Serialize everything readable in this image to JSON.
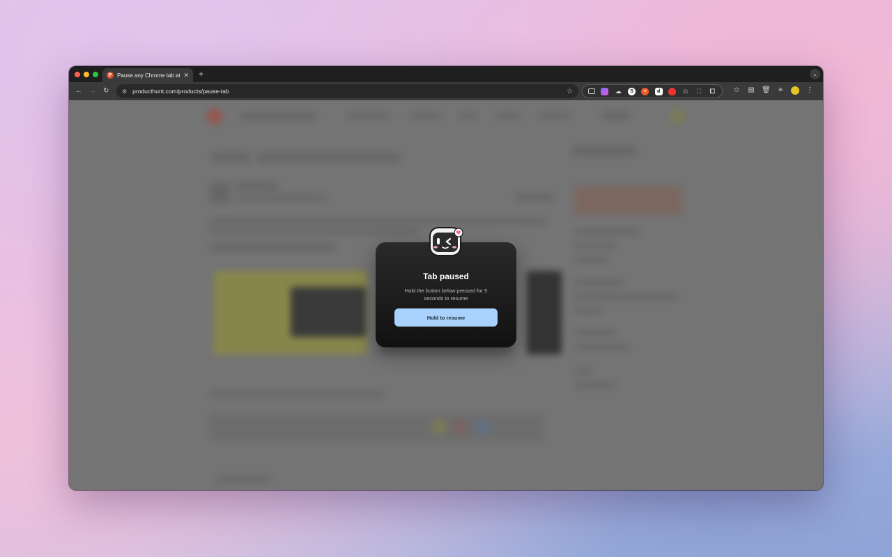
{
  "browser": {
    "tab": {
      "favicon_letter": "P",
      "title": "Pause any Chrome tab at will",
      "close_glyph": "✕"
    },
    "new_tab_glyph": "+",
    "tab_menu_glyph": "⌄",
    "url": "producthunt.com/products/pause-tab",
    "extensions": [
      "tab-icon",
      "gem-icon",
      "cloud-icon",
      "s-icon",
      "plus-icon",
      "d-icon",
      "shield-icon",
      "puzzle-dim-icon",
      "expand-icon",
      "puzzle-icon"
    ]
  },
  "modal": {
    "title": "Tab paused",
    "description": "Hold the button below pressed for 5 seconds to resume",
    "button_label": "Hold to resume"
  },
  "colors": {
    "accent_button": "#a8d1fb",
    "modal_bg": "#111111",
    "overlay": "#808080"
  }
}
